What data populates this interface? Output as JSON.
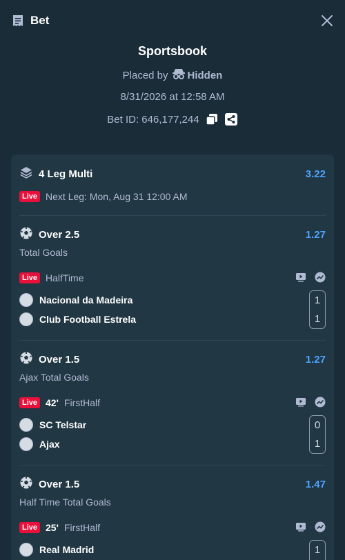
{
  "header": {
    "title": "Bet",
    "icon": "receipt-icon",
    "close_icon": "close-icon"
  },
  "summary": {
    "book": "Sportsbook",
    "placed_by_prefix": "Placed by",
    "placed_by_name": "Hidden",
    "date": "8/31/2026 at 12:58 AM",
    "bet_id": "Bet ID: 646,177,244"
  },
  "multi": {
    "label": "4 Leg Multi",
    "odds": "3.22",
    "live": "Live",
    "next_leg": "Next Leg: Mon, Aug 31 12:00 AM"
  },
  "legs": [
    {
      "selection": "Over 2.5",
      "odds": "1.27",
      "market": "Total Goals",
      "live": "Live",
      "minute": "",
      "period": "HalfTime",
      "team1": "Nacional da Madeira",
      "score1": "1",
      "team2": "Club Football Estrela",
      "score2": "1"
    },
    {
      "selection": "Over 1.5",
      "odds": "1.27",
      "market": "Ajax Total Goals",
      "live": "Live",
      "minute": "42'",
      "period": "FirstHalf",
      "team1": "SC Telstar",
      "score1": "0",
      "team2": "Ajax",
      "score2": "1"
    },
    {
      "selection": "Over 1.5",
      "odds": "1.47",
      "market": "Half Time Total Goals",
      "live": "Live",
      "minute": "25'",
      "period": "FirstHalf",
      "team1": "Real Madrid",
      "score1": "1"
    }
  ],
  "colors": {
    "background": "#1a2c38",
    "card": "#213743",
    "accent_blue": "#4ea3ff",
    "live_red": "#e9113c",
    "muted_text": "#b1bad3"
  }
}
